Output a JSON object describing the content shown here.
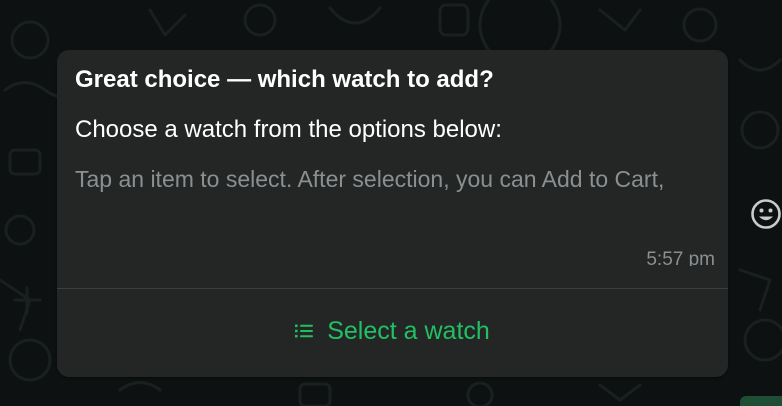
{
  "message": {
    "title": "Great choice — which watch to add?",
    "subtitle": "Choose a watch from the options below:",
    "hint": "Tap an item to select. After selection, you can Add to Cart,",
    "timestamp": "5:57 pm",
    "action_icon": "list-icon",
    "action_label": "Select a watch"
  },
  "toolbar": {
    "emoji_icon": "smiley-icon"
  },
  "colors": {
    "bubble_background": "#242626",
    "accent_green": "#21c063",
    "secondary_text": "#8a8f91",
    "primary_text": "#ffffff",
    "chat_background": "#0d1111"
  }
}
